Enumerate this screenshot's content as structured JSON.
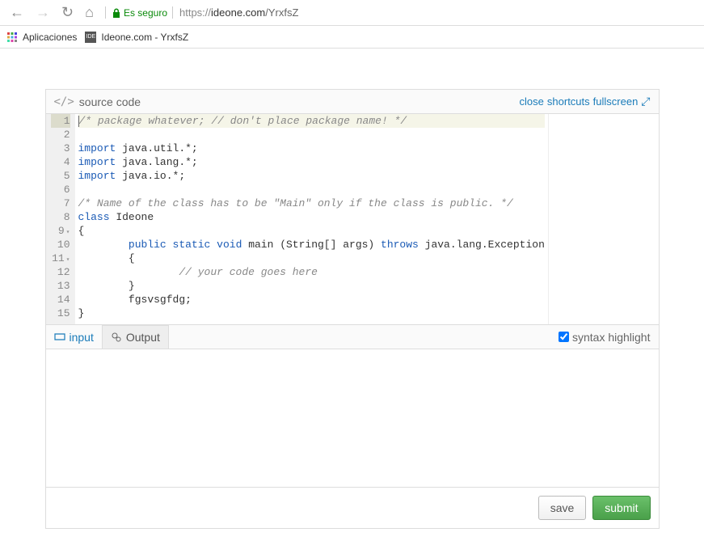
{
  "browser": {
    "secure_label": "Es seguro",
    "url_prefix": "https://",
    "url_host": "ideone.com",
    "url_path": "/YrxfsZ"
  },
  "bookmarks": {
    "apps_label": "Aplicaciones",
    "items": [
      {
        "label": "Ideone.com - YrxfsZ"
      }
    ]
  },
  "editor": {
    "title": "source code",
    "close_label": "close",
    "shortcuts_label": "shortcuts",
    "fullscreen_label": "fullscreen"
  },
  "code_lines": [
    {
      "n": 1,
      "hl": true,
      "tokens": [
        {
          "t": "/* package whatever; // don't place package name! */",
          "c": "c-comment"
        }
      ]
    },
    {
      "n": 2,
      "tokens": []
    },
    {
      "n": 3,
      "tokens": [
        {
          "t": "import",
          "c": "c-keyword"
        },
        {
          "t": " java.util.*;",
          "c": ""
        }
      ]
    },
    {
      "n": 4,
      "tokens": [
        {
          "t": "import",
          "c": "c-keyword"
        },
        {
          "t": " java.lang.*;",
          "c": ""
        }
      ]
    },
    {
      "n": 5,
      "tokens": [
        {
          "t": "import",
          "c": "c-keyword"
        },
        {
          "t": " java.io.*;",
          "c": ""
        }
      ]
    },
    {
      "n": 6,
      "tokens": []
    },
    {
      "n": 7,
      "tokens": [
        {
          "t": "/* Name of the class has to be \"Main\" only if the class is public. */",
          "c": "c-comment"
        }
      ]
    },
    {
      "n": 8,
      "tokens": [
        {
          "t": "class",
          "c": "c-keyword"
        },
        {
          "t": " Ideone",
          "c": ""
        }
      ]
    },
    {
      "n": 9,
      "fold": true,
      "tokens": [
        {
          "t": "{",
          "c": ""
        }
      ]
    },
    {
      "n": 10,
      "tokens": [
        {
          "t": "        ",
          "c": ""
        },
        {
          "t": "public",
          "c": "c-keyword"
        },
        {
          "t": " ",
          "c": ""
        },
        {
          "t": "static",
          "c": "c-keyword"
        },
        {
          "t": " ",
          "c": ""
        },
        {
          "t": "void",
          "c": "c-keyword"
        },
        {
          "t": " main (String[] args) ",
          "c": ""
        },
        {
          "t": "throws",
          "c": "c-keyword"
        },
        {
          "t": " java.lang.Exception",
          "c": ""
        }
      ]
    },
    {
      "n": 11,
      "fold": true,
      "tokens": [
        {
          "t": "        {",
          "c": ""
        }
      ]
    },
    {
      "n": 12,
      "tokens": [
        {
          "t": "                ",
          "c": ""
        },
        {
          "t": "// your code goes here",
          "c": "c-comment"
        }
      ]
    },
    {
      "n": 13,
      "tokens": [
        {
          "t": "        }",
          "c": ""
        }
      ]
    },
    {
      "n": 14,
      "tokens": [
        {
          "t": "        fgsvsgfdg;",
          "c": ""
        }
      ]
    },
    {
      "n": 15,
      "tokens": [
        {
          "t": "}",
          "c": ""
        }
      ]
    }
  ],
  "tabs": {
    "input_label": "input",
    "output_label": "Output",
    "syntax_label": "syntax highlight",
    "syntax_checked": true
  },
  "buttons": {
    "save": "save",
    "submit": "submit"
  }
}
